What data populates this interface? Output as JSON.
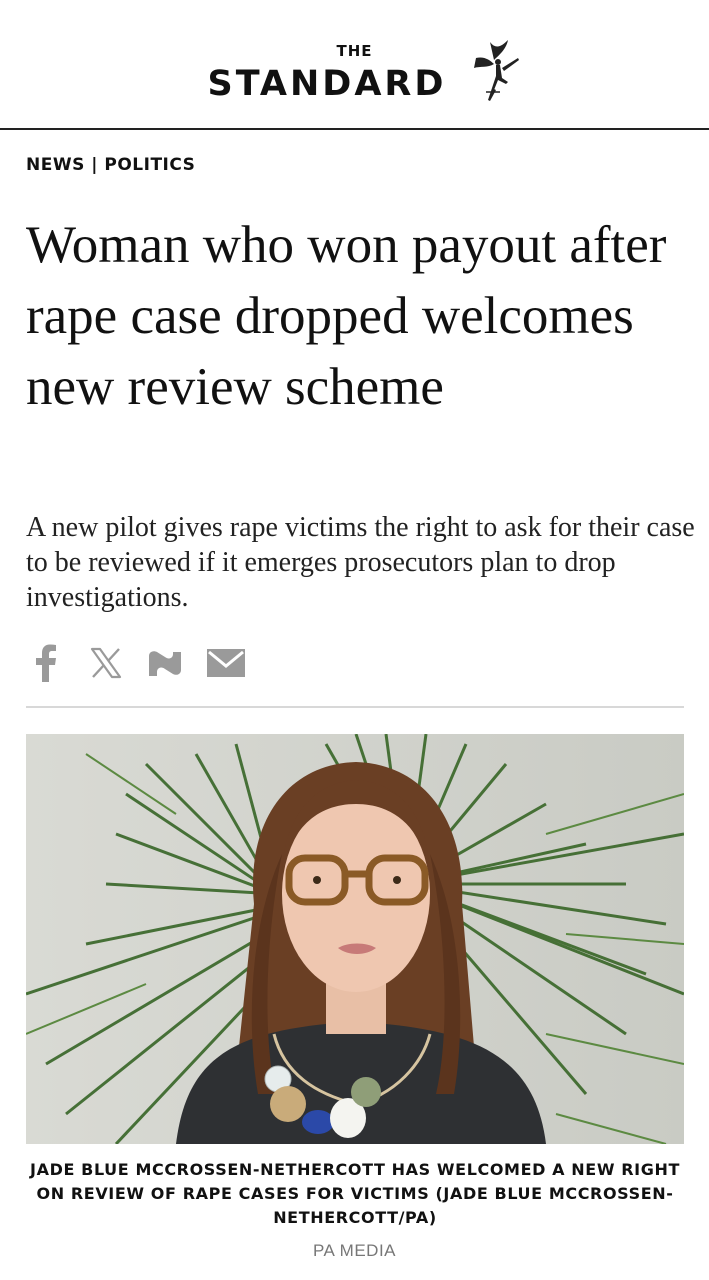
{
  "masthead": {
    "the": "THE",
    "name": "STANDARD"
  },
  "section": {
    "label": "NEWS | POLITICS"
  },
  "article": {
    "headline": "Woman who won payout after rape case dropped welcomes new review scheme",
    "standfirst": "A new pilot gives rape victims the right to ask for their case to be reviewed if it emerges prosecutors plan to drop investigations."
  },
  "share": {
    "icons": [
      "facebook-icon",
      "x-icon",
      "newsnow-icon",
      "email-icon"
    ],
    "icon_color": "#9a9a9a"
  },
  "image": {
    "caption": "JADE BLUE MCCROSSEN-NETHERCOTT HAS WELCOMED A NEW RIGHT ON REVIEW OF RAPE CASES FOR VICTIMS (JADE BLUE MCCROSSEN-NETHERCOTT/PA)",
    "credit": "PA MEDIA"
  }
}
